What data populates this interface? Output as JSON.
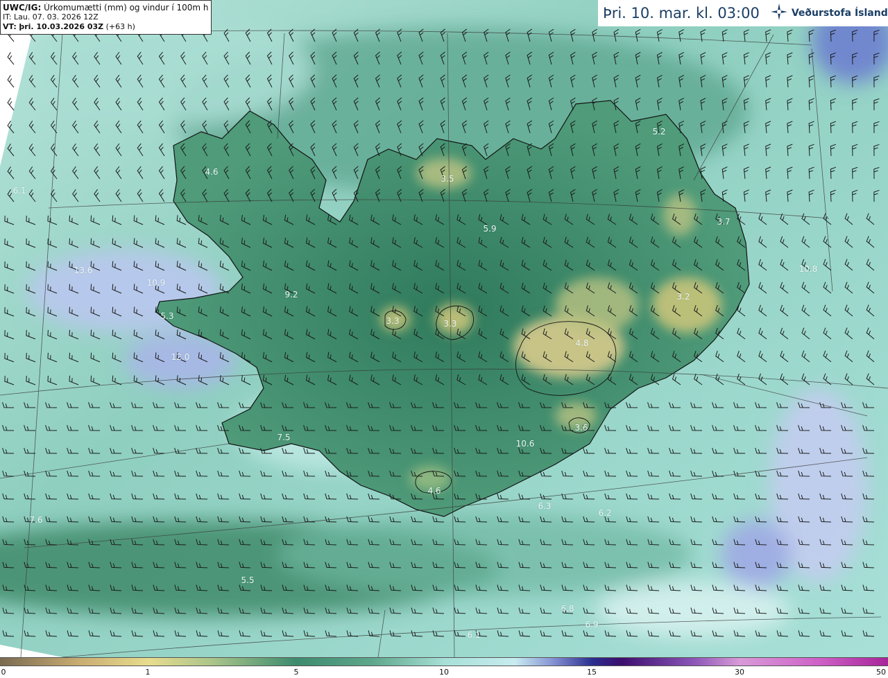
{
  "header": {
    "product": "UWC/IG:",
    "description": "Úrkomumætti (mm) og vindur í 100m hæð",
    "it_label": "IT: Lau. 07. 03. 2026 12Z",
    "vt_prefix": "VT:",
    "vt_value": "þri. 10.03.2026 03Z",
    "vt_offset": "(+63 h)"
  },
  "title": {
    "valid_time": "Þri. 10. mar. kl. 03:00",
    "logo_text": "Veðurstofa Íslands",
    "logo_icon": "vedurstofa-logo-icon"
  },
  "map": {
    "values": [
      "4.6",
      "3.5",
      "5.2",
      "3.7",
      "3.3",
      "3.3",
      "5.3",
      "6.1",
      "7.5",
      "7.6",
      "5.5",
      "4.6",
      "6.3",
      "6.2",
      "6.1",
      "3.6",
      "6.9",
      "10.6",
      "12.0",
      "10.8",
      "6.8",
      "5.9",
      "9.2",
      "10.9",
      "13.6",
      "4.8",
      "3.2"
    ],
    "colors": {
      "land_green": "#3f8a6a",
      "sea_teal": "#8fcfc0",
      "highland_yellow": "#c8c47a",
      "heavy_blue": "#9aa8e0",
      "coast_line": "#111111"
    }
  },
  "colorbar": {
    "ticks": [
      "0",
      "1",
      "5",
      "10",
      "15",
      "30",
      "50"
    ],
    "ramp_colors": [
      "#7a6a50",
      "#e8dc8e",
      "#3d8b6e",
      "#a7e0d6",
      "#2b2e8f",
      "#d89ad8",
      "#a8259a"
    ]
  }
}
